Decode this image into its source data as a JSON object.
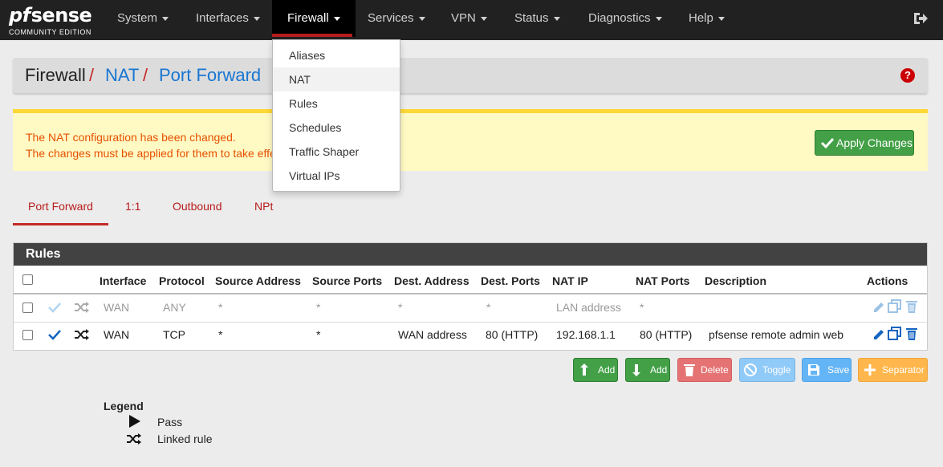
{
  "logo": {
    "pf": "pf",
    "sense": "sense",
    "sub": "COMMUNITY EDITION"
  },
  "nav": {
    "items": [
      "System",
      "Interfaces",
      "Firewall",
      "Services",
      "VPN",
      "Status",
      "Diagnostics",
      "Help"
    ],
    "active": "Firewall",
    "logout_icon": "sign-out-icon"
  },
  "breadcrumb": {
    "part1": "Firewall",
    "part2": "NAT",
    "part3": "Port Forward",
    "sep": "/"
  },
  "help_icon": "question-circle-icon",
  "alert": {
    "line1": "The NAT configuration has been changed.",
    "line2": "The changes must be applied for them to take effe",
    "apply_label": "Apply Changes"
  },
  "tabs": [
    "Port Forward",
    "1:1",
    "Outbound",
    "NPt"
  ],
  "active_tab": "Port Forward",
  "rules": {
    "title": "Rules",
    "columns": [
      "Interface",
      "Protocol",
      "Source Address",
      "Source Ports",
      "Dest. Address",
      "Dest. Ports",
      "NAT IP",
      "NAT Ports",
      "Description",
      "Actions"
    ],
    "rows": [
      {
        "enabled": false,
        "interface": "WAN",
        "protocol": "ANY",
        "src_addr": "*",
        "src_ports": "*",
        "dest_addr": "*",
        "dest_ports": "*",
        "nat_ip": "LAN address",
        "nat_ports": "*",
        "description": ""
      },
      {
        "enabled": true,
        "interface": "WAN",
        "protocol": "TCP",
        "src_addr": "*",
        "src_ports": "*",
        "dest_addr": "WAN address",
        "dest_ports": "80 (HTTP)",
        "nat_ip": "192.168.1.1",
        "nat_ports": "80 (HTTP)",
        "description": "pfsense remote admin web"
      }
    ]
  },
  "buttons": {
    "add_top": "Add",
    "add_bottom": "Add",
    "delete": "Delete",
    "toggle": "Toggle",
    "save": "Save",
    "separator": "Separator"
  },
  "legend": {
    "title": "Legend",
    "pass": "Pass",
    "linked": "Linked rule"
  },
  "dropdown": {
    "items": [
      "Aliases",
      "NAT",
      "Rules",
      "Schedules",
      "Traffic Shaper",
      "Virtual IPs"
    ],
    "highlighted": "NAT"
  },
  "colors": {
    "navbar": "#212121",
    "accent_red": "#b71c1c",
    "success": "#43a047",
    "link_blue": "#1976d2"
  }
}
